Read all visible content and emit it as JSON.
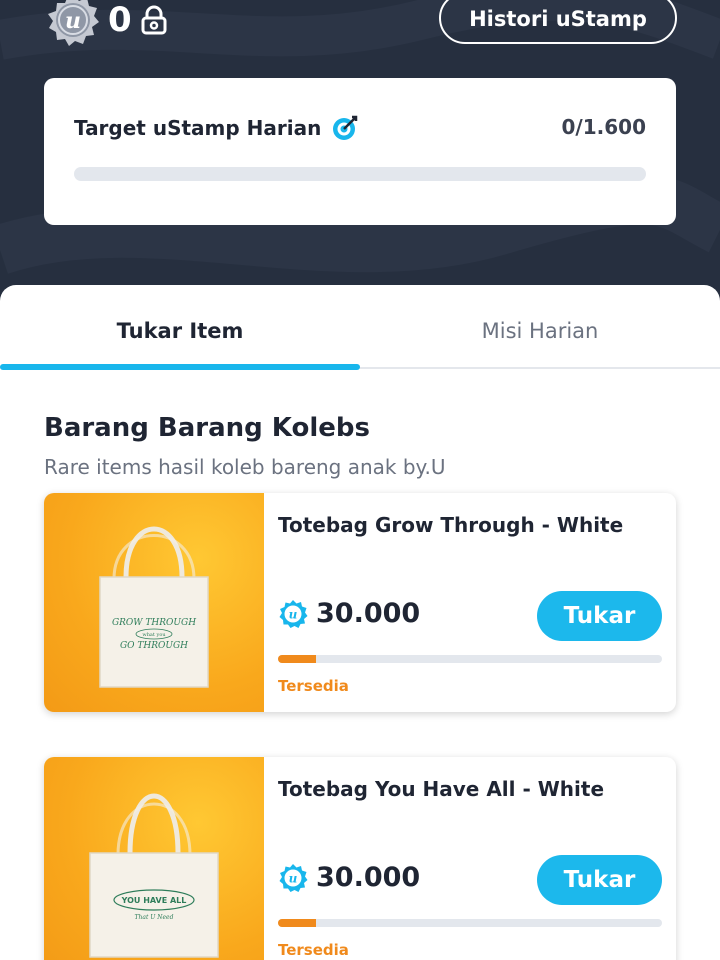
{
  "header": {
    "balance": "0",
    "history_button": "Histori uStamp"
  },
  "target": {
    "title": "Target uStamp Harian",
    "count": "0/1.600",
    "progress": 0
  },
  "tabs": [
    {
      "label": "Tukar Item",
      "active": true
    },
    {
      "label": "Misi Harian",
      "active": false
    }
  ],
  "section": {
    "title": "Barang Barang Kolebs",
    "subtitle": "Rare items hasil koleb bareng anak by.U"
  },
  "products": [
    {
      "name": "Totebag Grow Through - White",
      "price": "30.000",
      "button": "Tukar",
      "stock_label": "Tersedia",
      "stock_fraction": 0.1,
      "bag_text": [
        "GROW THROUGH",
        "what you",
        "GO THROUGH"
      ]
    },
    {
      "name": "Totebag You Have All - White",
      "price": "30.000",
      "button": "Tukar",
      "stock_label": "Tersedia",
      "stock_fraction": 0.1,
      "bag_text": [
        "YOU HAVE ALL",
        "That U Need"
      ]
    }
  ],
  "colors": {
    "header_bg": "#262f3f",
    "accent": "#18b6ec",
    "stock": "#f08a1c",
    "product_bg": "#f9a81c"
  }
}
